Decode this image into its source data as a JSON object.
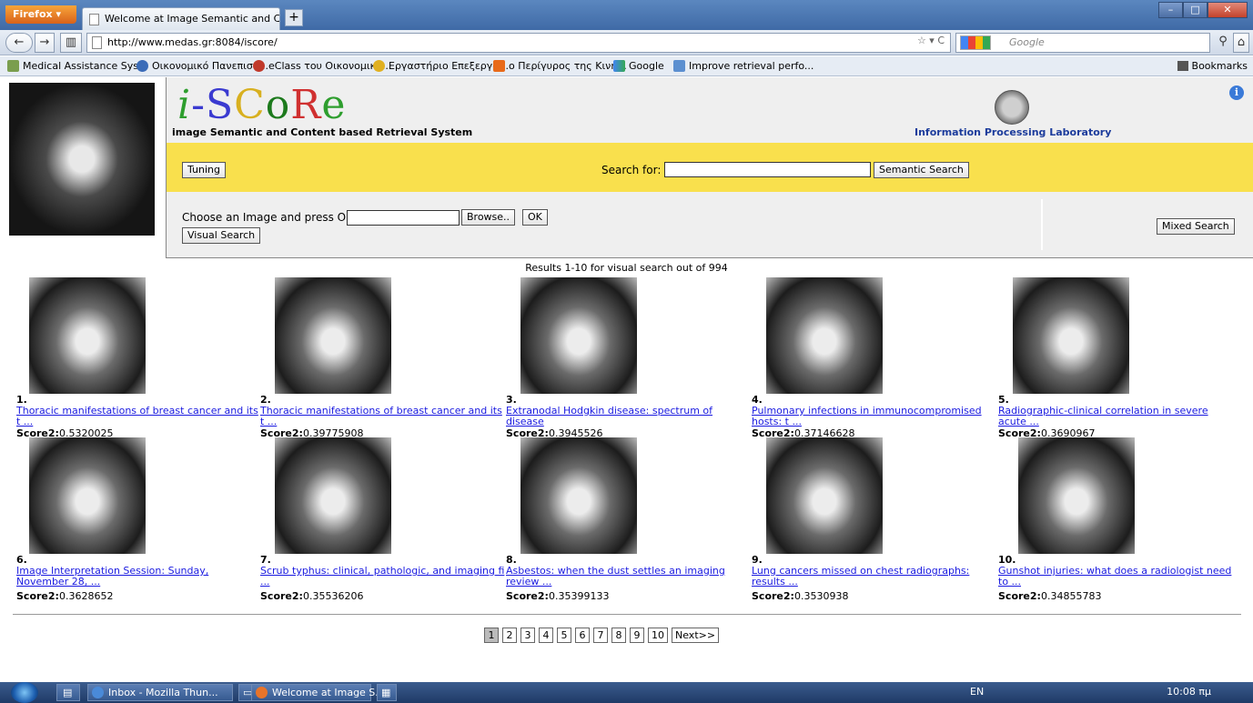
{
  "browser": {
    "firefox_label": "Firefox",
    "tab_title": "Welcome at Image Semantic and COnte...",
    "new_tab": "+",
    "url": "http://www.medas.gr:8084/iscore/",
    "search_placeholder": "Google",
    "bookmarks": [
      "Medical Assistance Sys...",
      "Οικονομικό Πανεπιστ...",
      "eClass του Οικονομικο...",
      "Εργαστήριο Επεξεργα...",
      "ο Περίγυρος της Κινη...",
      "Google",
      "Improve retrieval perfo..."
    ],
    "bookmarks_menu": "Bookmarks"
  },
  "header": {
    "logo_i": "i",
    "logo_dash": "-",
    "logo_s": "S",
    "logo_c": "C",
    "logo_o": "o",
    "logo_r": "R",
    "logo_e": "e",
    "tagline": "image Semantic and Content based Retrieval System",
    "lab": "Information Processing Laboratory"
  },
  "search": {
    "tuning": "Tuning",
    "search_for": "Search for:",
    "semantic_search": "Semantic Search",
    "choose_image": "Choose an Image and press OK",
    "browse": "Browse..",
    "ok": "OK",
    "visual_search": "Visual Search",
    "mixed_search": "Mixed Search"
  },
  "results_header": "Results 1-10 for visual search out of 994",
  "results": [
    {
      "num": "1.",
      "title": "Thoracic manifestations of breast cancer and its t ...",
      "score_label": "Score2:",
      "score": "0.5320025"
    },
    {
      "num": "2.",
      "title": "Thoracic manifestations of breast cancer and its t ...",
      "score_label": "Score2:",
      "score": "0.39775908"
    },
    {
      "num": "3.",
      "title": "Extranodal Hodgkin disease: spectrum of disease",
      "score_label": "Score2:",
      "score": "0.3945526"
    },
    {
      "num": "4.",
      "title": "Pulmonary infections in immunocompromised hosts: t ...",
      "score_label": "Score2:",
      "score": "0.37146628"
    },
    {
      "num": "5.",
      "title": "Radiographic-clinical correlation in severe acute ...",
      "score_label": "Score2:",
      "score": "0.3690967"
    },
    {
      "num": "6.",
      "title": "Image Interpretation Session: Sunday, November 28, ...",
      "score_label": "Score2:",
      "score": "0.3628652"
    },
    {
      "num": "7.",
      "title": "Scrub typhus: clinical, pathologic, and imaging fi ...",
      "score_label": "Score2:",
      "score": "0.35536206"
    },
    {
      "num": "8.",
      "title": "Asbestos: when the dust settles an imaging review ...",
      "score_label": "Score2:",
      "score": "0.35399133"
    },
    {
      "num": "9.",
      "title": "Lung cancers missed on chest radiographs: results ...",
      "score_label": "Score2:",
      "score": "0.3530938"
    },
    {
      "num": "10.",
      "title": "Gunshot injuries: what does a radiologist need to ...",
      "score_label": "Score2:",
      "score": "0.34855783"
    }
  ],
  "pager": [
    "1",
    "2",
    "3",
    "4",
    "5",
    "6",
    "7",
    "8",
    "9",
    "10",
    "Next>>"
  ],
  "taskbar": {
    "items": [
      "Inbox - Mozilla Thun...",
      "Welcome at Image S..."
    ],
    "lang": "EN",
    "time": "10:08 πμ"
  }
}
